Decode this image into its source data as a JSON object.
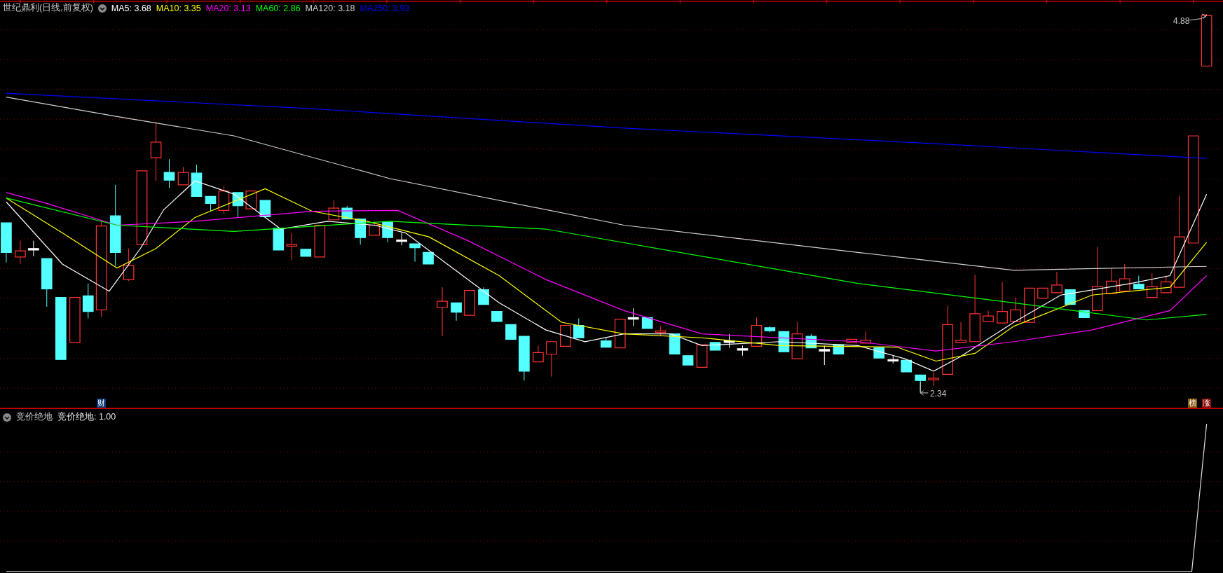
{
  "main_panel": {
    "title": "世纪鼎利(日线,前复权)",
    "moving_averages": [
      {
        "label": "MA5: 3.68",
        "color": "#ffffff"
      },
      {
        "label": "MA10: 3.35",
        "color": "#ffff00"
      },
      {
        "label": "MA20: 3.13",
        "color": "#ff00ff"
      },
      {
        "label": "MA60: 2.86",
        "color": "#00ff00"
      },
      {
        "label": "MA120: 3.18",
        "color": "#d0d0d0"
      },
      {
        "label": "MA250: 3.93",
        "color": "#0000ff"
      }
    ],
    "high_annotation": "4.88",
    "low_annotation": "2.34",
    "markers": [
      {
        "text": "财",
        "kind": "finance"
      },
      {
        "text": "榜",
        "kind": "list"
      },
      {
        "text": "涨",
        "kind": "limit"
      }
    ]
  },
  "indicator_panel": {
    "name": "竞价绝地",
    "reading": "竞价绝地: 1.00"
  }
}
